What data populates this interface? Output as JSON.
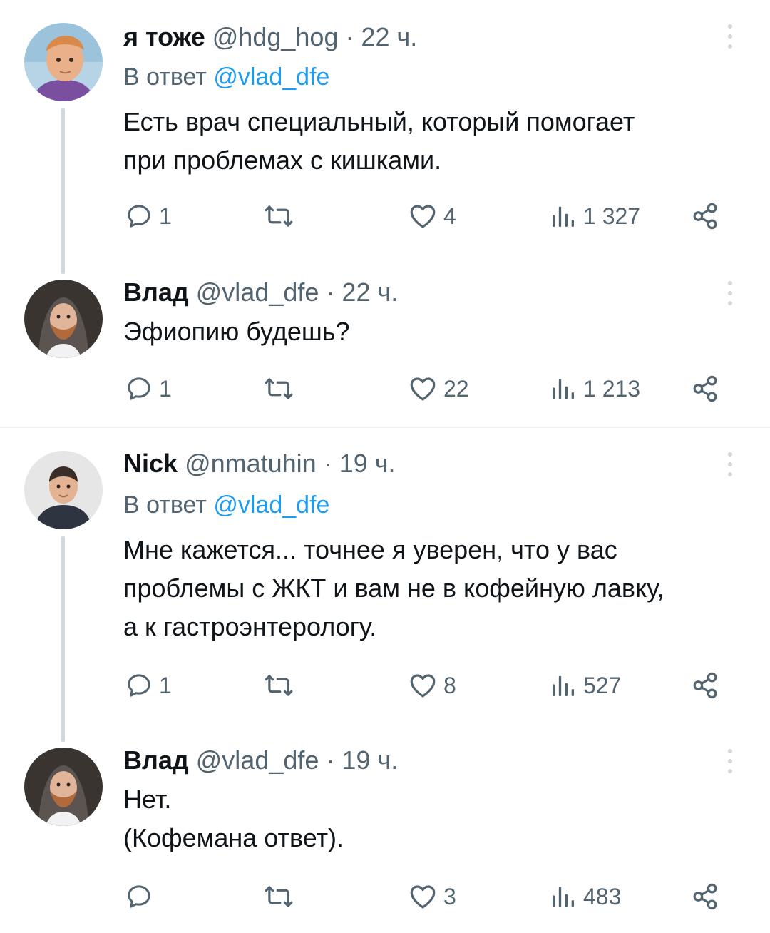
{
  "tweets": [
    {
      "name": "я тоже",
      "handle": "@hdg_hog",
      "time": "· 22 ч.",
      "reply_prefix": "В ответ",
      "reply_to": "@vlad_dfe",
      "lines": [
        "Есть врач специальный, который помогает",
        "при проблемах с кишками."
      ],
      "replies": "1",
      "retweets": "",
      "likes": "4",
      "views": "1 327"
    },
    {
      "name": "Влад",
      "handle": "@vlad_dfe",
      "time": "· 22 ч.",
      "lines": [
        "Эфиопию будешь?"
      ],
      "replies": "1",
      "retweets": "",
      "likes": "22",
      "views": "1 213"
    },
    {
      "name": "Nick",
      "handle": "@nmatuhin",
      "time": "· 19 ч.",
      "reply_prefix": "В ответ",
      "reply_to": "@vlad_dfe",
      "lines": [
        "Мне кажется... точнее я уверен, что у вас",
        "проблемы с ЖКТ и вам не в кофейную лавку,",
        "а к гастроэнтерологу."
      ],
      "replies": "1",
      "retweets": "",
      "likes": "8",
      "views": "527"
    },
    {
      "name": "Влад",
      "handle": "@vlad_dfe",
      "time": "· 19 ч.",
      "lines": [
        "Нет.",
        "(Кофемана ответ)."
      ],
      "replies": "",
      "retweets": "",
      "likes": "3",
      "views": "483"
    }
  ],
  "colors": {
    "text": "#0f1419",
    "secondary": "#536471",
    "link": "#1d9bf0",
    "line": "#cfd9de"
  },
  "icons": [
    "reply-icon",
    "retweet-icon",
    "like-icon",
    "views-icon",
    "share-icon",
    "more-icon"
  ]
}
